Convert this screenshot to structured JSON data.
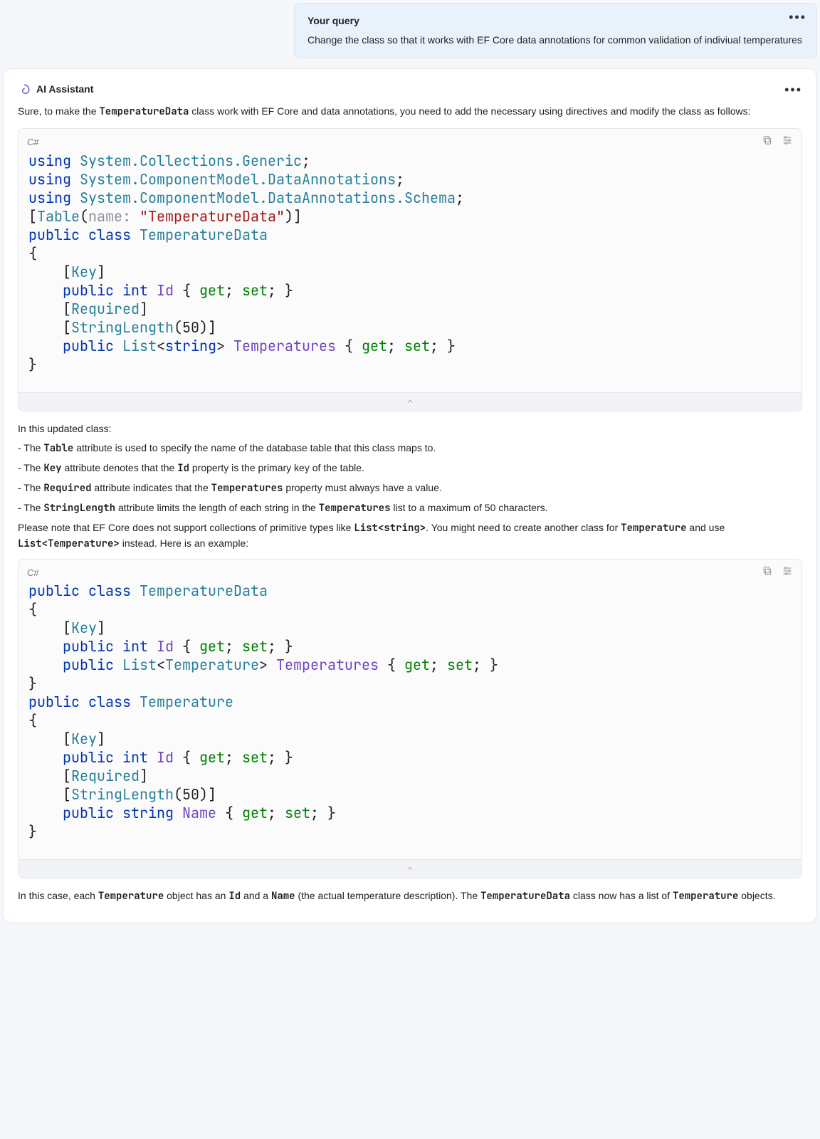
{
  "query": {
    "title": "Your query",
    "text": "Change the class so that it works with EF Core data annotations for common validation of indiviual temperatures"
  },
  "answer": {
    "header": "AI Assistant",
    "intro_pre": "Sure, to make the ",
    "intro_code1": "TemperatureData",
    "intro_post": " class work with EF Core and data annotations, you need to add the necessary using directives and modify the class as follows:"
  },
  "codeblock1": {
    "lang": "C#"
  },
  "explanation1": {
    "lead": "In this updated class:",
    "b1_pre": "- The ",
    "b1_code": "Table",
    "b1_post": " attribute is used to specify the name of the database table that this class maps to.",
    "b2_pre": "- The ",
    "b2_code": "Key",
    "b2_code2": "Id",
    "b2_mid": " attribute denotes that the ",
    "b2_post": " property is the primary key of the table.",
    "b3_pre": "- The ",
    "b3_code": "Required",
    "b3_mid": " attribute indicates that the ",
    "b3_code2": "Temperatures",
    "b3_post": " property must always have a value.",
    "b4_pre": "- The ",
    "b4_code": "StringLength",
    "b4_mid": " attribute limits the length of each string in the ",
    "b4_code2": "Temperatures",
    "b4_post": " list to a maximum of 50 characters.",
    "note_pre": "Please note that EF Core does not support collections of primitive types like ",
    "note_code1": "List<string>",
    "note_mid": ". You might need to create another class for ",
    "note_code2": "Temperature",
    "note_mid2": " and use ",
    "note_code3": "List<Temperature>",
    "note_post": " instead. Here is an example:"
  },
  "codeblock2": {
    "lang": "C#"
  },
  "explanation2": {
    "pre": "In this case, each ",
    "c1": "Temperature",
    "mid1": " object has an ",
    "c2": "Id",
    "mid2": " and a ",
    "c3": "Name",
    "mid3": " (the actual temperature description). The ",
    "c4": "TemperatureData",
    "mid4": " class now has a list of ",
    "c5": "Temperature",
    "post": " objects."
  },
  "code1_lines": {
    "using": "using",
    "ns1": "System.Collections.Generic",
    "ns2": "System.ComponentModel.DataAnnotations",
    "ns3": "System.ComponentModel.DataAnnotations.Schema",
    "table": "Table",
    "name_param": "name:",
    "table_str": "\"TemperatureData\"",
    "public": "public",
    "class": "class",
    "cls1": "TemperatureData",
    "key": "Key",
    "int": "int",
    "id_prop": "Id",
    "get": "get",
    "set": "set",
    "required": "Required",
    "strlen": "StringLength",
    "fifty": "50",
    "list": "List",
    "string": "string",
    "temps_prop": "Temperatures"
  },
  "code2_lines": {
    "public": "public",
    "class": "class",
    "cls1": "TemperatureData",
    "cls2": "Temperature",
    "key": "Key",
    "int": "int",
    "id_prop": "Id",
    "get": "get",
    "set": "set",
    "list": "List",
    "temp_ty": "Temperature",
    "temps_prop": "Temperatures",
    "required": "Required",
    "strlen": "StringLength",
    "fifty": "50",
    "string": "string",
    "name_prop": "Name"
  }
}
